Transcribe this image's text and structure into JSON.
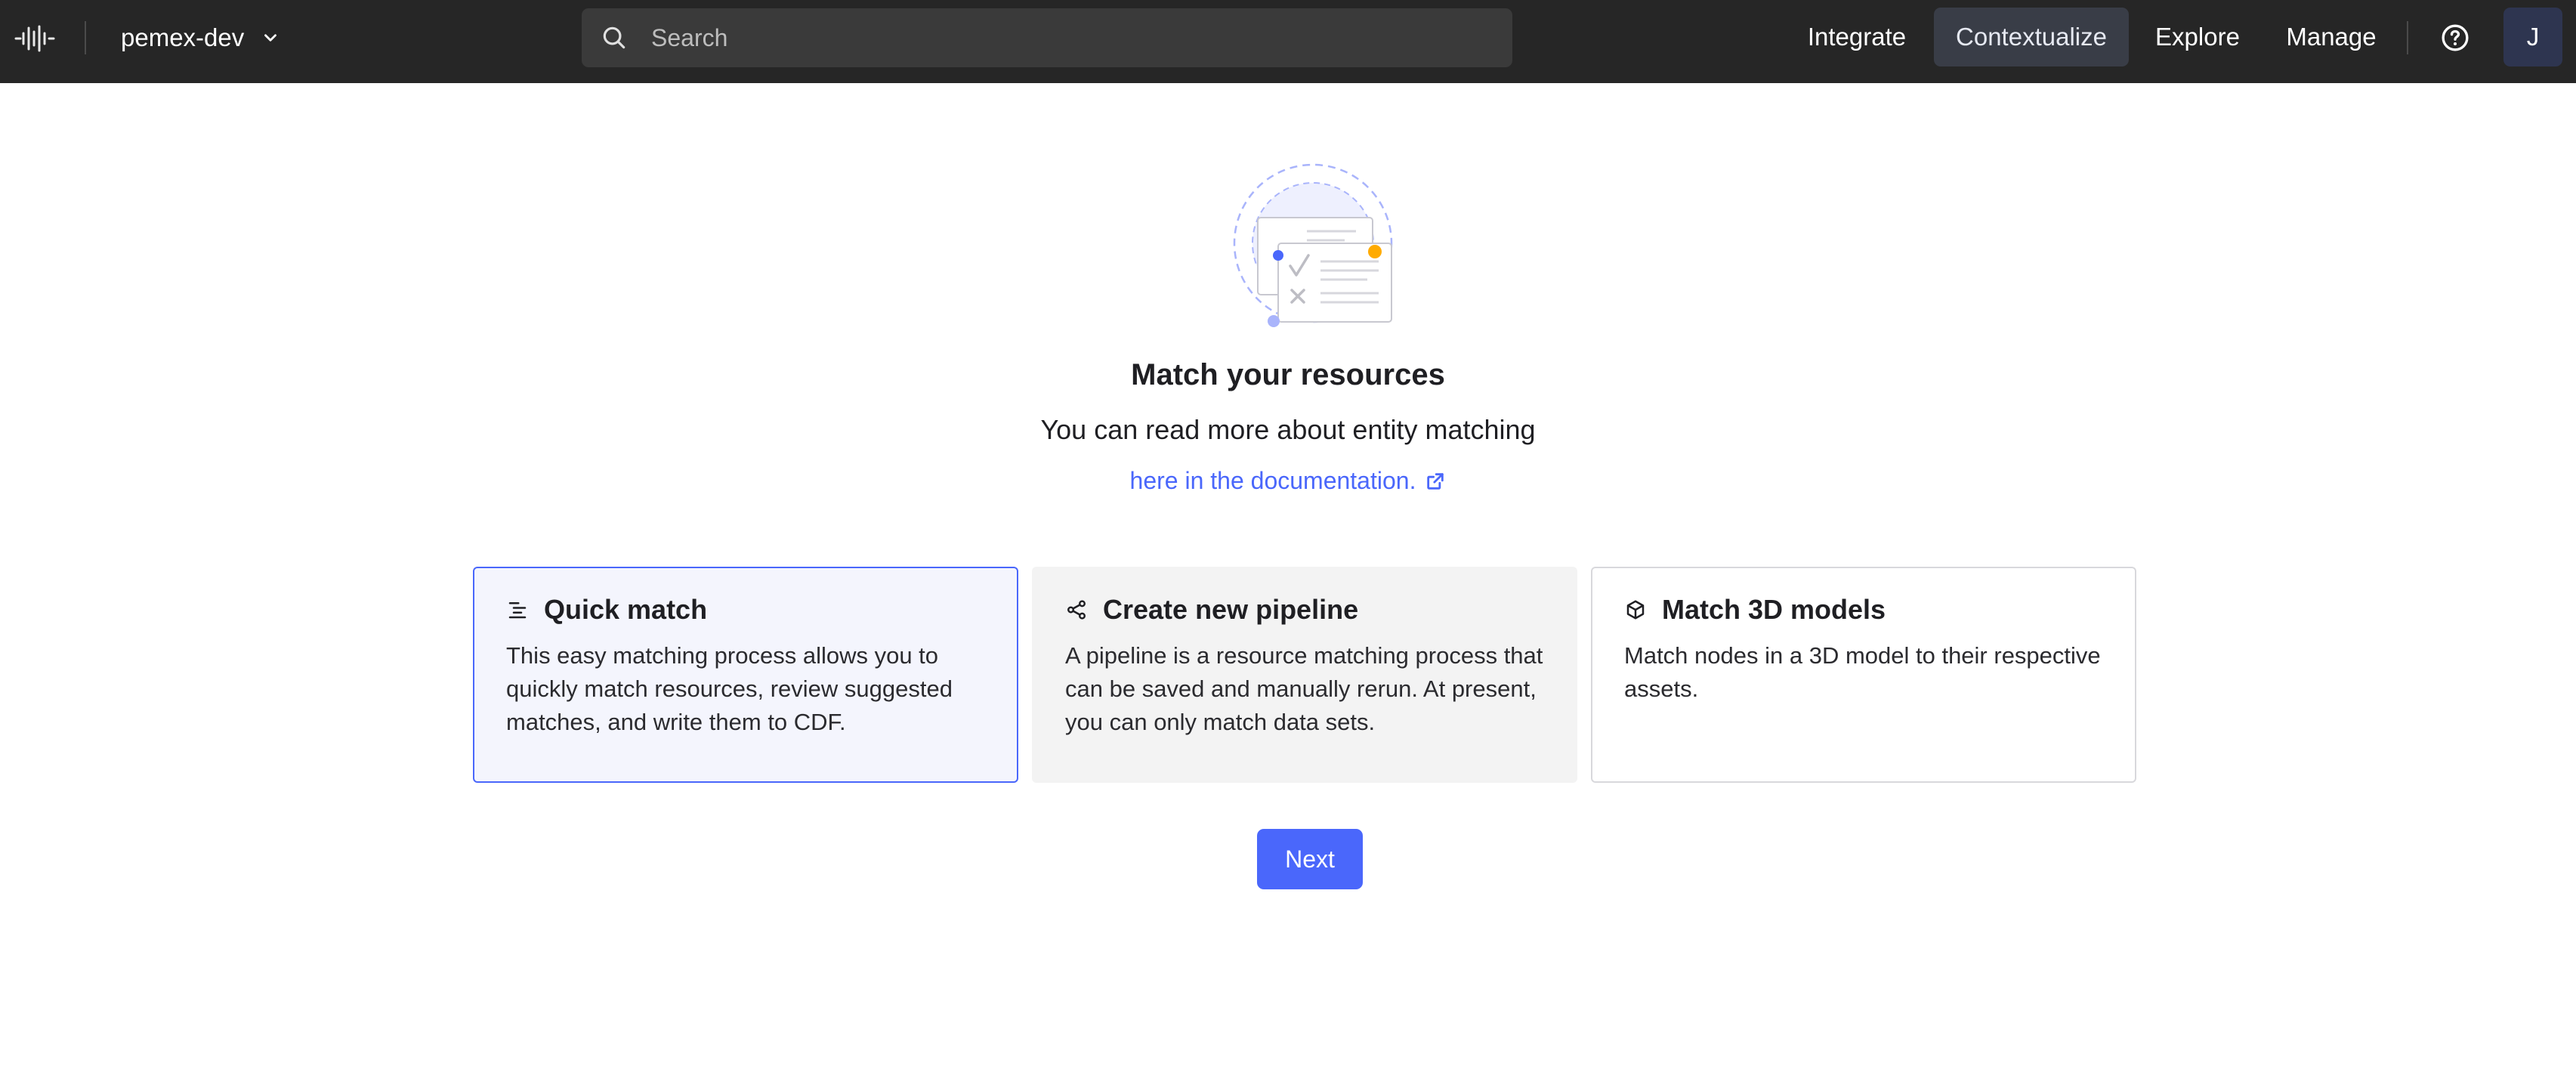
{
  "topbar": {
    "project_name": "pemex-dev",
    "search_placeholder": "Search",
    "nav": [
      {
        "label": "Integrate"
      },
      {
        "label": "Contextualize"
      },
      {
        "label": "Explore"
      },
      {
        "label": "Manage"
      }
    ],
    "active_nav": "Contextualize",
    "avatar_initial": "J"
  },
  "main": {
    "title": "Match your resources",
    "subtitle": "You can read more about entity matching",
    "doc_link": "here in the documentation.",
    "cards": [
      {
        "title": "Quick match",
        "description": "This easy matching process allows you to quickly match resources, review suggested matches, and write them to CDF.",
        "icon": "list-indent-icon",
        "selected": true
      },
      {
        "title": "Create new pipeline",
        "description": "A pipeline is a resource matching process that can be saved and manually rerun. At present, you can only match data sets.",
        "icon": "share-nodes-icon",
        "selected": false
      },
      {
        "title": "Match 3D models",
        "description": "Match nodes in a 3D model to their respective assets.",
        "icon": "cube-icon",
        "selected": false
      }
    ],
    "next_label": "Next"
  },
  "colors": {
    "topbar_bg": "#262626",
    "accent": "#4a67fb",
    "selected_card_bg": "#f4f5fd",
    "avatar_bg": "#2e3550"
  }
}
